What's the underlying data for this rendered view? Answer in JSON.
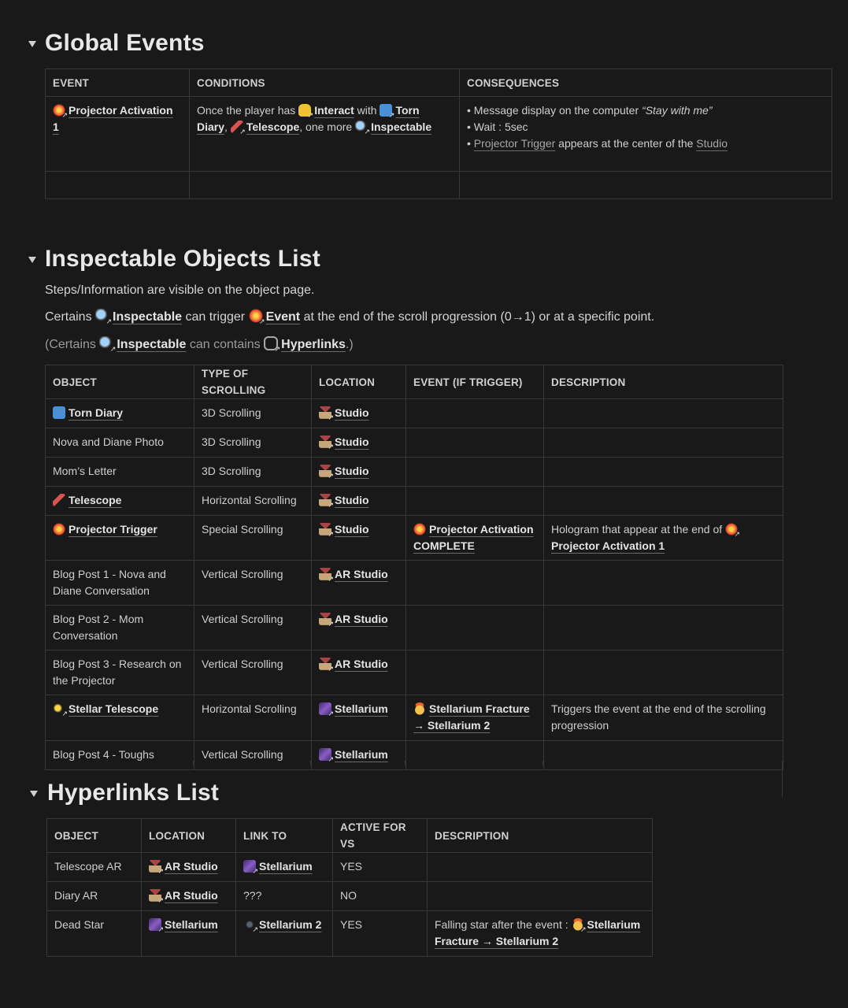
{
  "sections": {
    "global_events": {
      "title": "Global Events"
    },
    "inspectable": {
      "title": "Inspectable Objects List",
      "intro1": "Steps/Information are visible on the object page.",
      "intro2_a": "Certains",
      "intro2_link1": "Inspectable",
      "intro2_b": "can trigger",
      "intro2_link2": "Event",
      "intro2_c": "at the end of the scroll progression (0→1) or at a specific point.",
      "intro3_a": "(Certains",
      "intro3_link1": "Inspectable",
      "intro3_b": "can contains",
      "intro3_link2": "Hyperlinks",
      "intro3_c": ".)"
    },
    "hyperlinks": {
      "title": "Hyperlinks List"
    }
  },
  "events_table": {
    "headers": [
      "EVENT",
      "CONDITIONS",
      "CONSEQUENCES"
    ],
    "row1": {
      "event": "Projector Activation 1",
      "cond_a": "Once the player has",
      "cond_interact": "Interact",
      "cond_with": "with",
      "cond_torn": "Torn Diary",
      "cond_comma": ",",
      "cond_tele": "Telescope",
      "cond_more": ", one more",
      "cond_insp": "Inspectable",
      "cons1_a": "Message display on the computer",
      "cons1_quote": "“Stay with me”",
      "cons2": "Wait : 5sec",
      "cons3_link": "Projector Trigger",
      "cons3_a": "appears at the center of the",
      "cons3_link2": "Studio"
    }
  },
  "objects_table": {
    "headers": [
      "OBJECT",
      "TYPE OF SCROLLING",
      "LOCATION",
      "EVENT (IF TRIGGER)",
      "DESCRIPTION"
    ],
    "rows": [
      {
        "object": "Torn Diary",
        "type": "3D Scrolling",
        "location": "Studio"
      },
      {
        "object": "Nova and Diane Photo",
        "type": "3D Scrolling",
        "location": "Studio"
      },
      {
        "object": "Mom’s Letter",
        "type": "3D Scrolling",
        "location": "Studio"
      },
      {
        "object": "Telescope",
        "type": "Horizontal Scrolling",
        "location": "Studio"
      },
      {
        "object": "Projector Trigger",
        "type": "Special Scrolling",
        "location": "Studio",
        "event": "Projector Activation COMPLETE",
        "desc_a": "Hologram that appear at the end of",
        "desc_link": "Projector Activation 1"
      },
      {
        "object": "Blog Post 1 - Nova and Diane Conversation",
        "type": "Vertical Scrolling",
        "location": "AR Studio"
      },
      {
        "object": "Blog Post 2 - Mom Conversation",
        "type": "Vertical Scrolling",
        "location": "AR Studio"
      },
      {
        "object": "Blog Post 3 - Research on the Projector",
        "type": "Vertical Scrolling",
        "location": "AR Studio"
      },
      {
        "object": "Stellar Telescope",
        "type": "Horizontal Scrolling",
        "location": "Stellarium",
        "event": "Stellarium Fracture → Stellarium 2",
        "desc": "Triggers the event at the end of the scrolling progression"
      },
      {
        "object": "Blog Post 4 - Toughs",
        "type": "Vertical Scrolling",
        "location": "Stellarium"
      }
    ]
  },
  "hyperlinks_table": {
    "headers": [
      "OBJECT",
      "LOCATION",
      "LINK TO",
      "ACTIVE FOR VS",
      "DESCRIPTION"
    ],
    "rows": [
      {
        "object": "Telescope AR",
        "location": "AR Studio",
        "link_to": "Stellarium",
        "active": "YES"
      },
      {
        "object": "Diary AR",
        "location": "AR Studio",
        "link_to": "???",
        "active": "NO"
      },
      {
        "object": "Dead Star",
        "location": "Stellarium",
        "link_to": "Stellarium 2",
        "active": "YES",
        "desc_a": "Falling star after the event :",
        "desc_link": "Stellarium Fracture → Stellarium 2"
      }
    ]
  },
  "icons": {
    "event": "explosion-icon",
    "interact": "pointing-hand-icon",
    "diary": "blue-book-icon",
    "telescope": "telescope-icon",
    "inspectable": "magnifier-icon",
    "house": "house-icon",
    "stellarium": "milky-way-icon",
    "fracture": "exploding-head-icon",
    "sparkles": "sparkles-icon",
    "hyperlink": "link-icon",
    "stellarium2": "dark-star-icon"
  },
  "colors": {
    "background": "#191919",
    "border": "#373737",
    "text": "#d4d4d4",
    "muted": "#9b9b9b"
  }
}
